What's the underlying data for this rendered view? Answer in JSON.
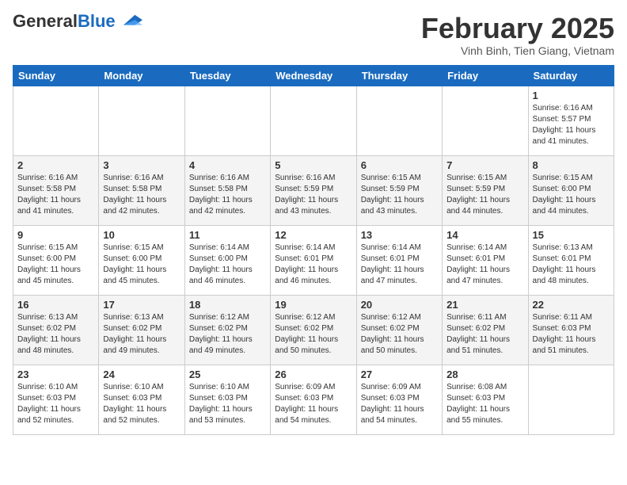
{
  "header": {
    "logo_general": "General",
    "logo_blue": "Blue",
    "month_title": "February 2025",
    "location": "Vinh Binh, Tien Giang, Vietnam"
  },
  "weekdays": [
    "Sunday",
    "Monday",
    "Tuesday",
    "Wednesday",
    "Thursday",
    "Friday",
    "Saturday"
  ],
  "weeks": [
    [
      {
        "day": "",
        "info": ""
      },
      {
        "day": "",
        "info": ""
      },
      {
        "day": "",
        "info": ""
      },
      {
        "day": "",
        "info": ""
      },
      {
        "day": "",
        "info": ""
      },
      {
        "day": "",
        "info": ""
      },
      {
        "day": "1",
        "info": "Sunrise: 6:16 AM\nSunset: 5:57 PM\nDaylight: 11 hours\nand 41 minutes."
      }
    ],
    [
      {
        "day": "2",
        "info": "Sunrise: 6:16 AM\nSunset: 5:58 PM\nDaylight: 11 hours\nand 41 minutes."
      },
      {
        "day": "3",
        "info": "Sunrise: 6:16 AM\nSunset: 5:58 PM\nDaylight: 11 hours\nand 42 minutes."
      },
      {
        "day": "4",
        "info": "Sunrise: 6:16 AM\nSunset: 5:58 PM\nDaylight: 11 hours\nand 42 minutes."
      },
      {
        "day": "5",
        "info": "Sunrise: 6:16 AM\nSunset: 5:59 PM\nDaylight: 11 hours\nand 43 minutes."
      },
      {
        "day": "6",
        "info": "Sunrise: 6:15 AM\nSunset: 5:59 PM\nDaylight: 11 hours\nand 43 minutes."
      },
      {
        "day": "7",
        "info": "Sunrise: 6:15 AM\nSunset: 5:59 PM\nDaylight: 11 hours\nand 44 minutes."
      },
      {
        "day": "8",
        "info": "Sunrise: 6:15 AM\nSunset: 6:00 PM\nDaylight: 11 hours\nand 44 minutes."
      }
    ],
    [
      {
        "day": "9",
        "info": "Sunrise: 6:15 AM\nSunset: 6:00 PM\nDaylight: 11 hours\nand 45 minutes."
      },
      {
        "day": "10",
        "info": "Sunrise: 6:15 AM\nSunset: 6:00 PM\nDaylight: 11 hours\nand 45 minutes."
      },
      {
        "day": "11",
        "info": "Sunrise: 6:14 AM\nSunset: 6:00 PM\nDaylight: 11 hours\nand 46 minutes."
      },
      {
        "day": "12",
        "info": "Sunrise: 6:14 AM\nSunset: 6:01 PM\nDaylight: 11 hours\nand 46 minutes."
      },
      {
        "day": "13",
        "info": "Sunrise: 6:14 AM\nSunset: 6:01 PM\nDaylight: 11 hours\nand 47 minutes."
      },
      {
        "day": "14",
        "info": "Sunrise: 6:14 AM\nSunset: 6:01 PM\nDaylight: 11 hours\nand 47 minutes."
      },
      {
        "day": "15",
        "info": "Sunrise: 6:13 AM\nSunset: 6:01 PM\nDaylight: 11 hours\nand 48 minutes."
      }
    ],
    [
      {
        "day": "16",
        "info": "Sunrise: 6:13 AM\nSunset: 6:02 PM\nDaylight: 11 hours\nand 48 minutes."
      },
      {
        "day": "17",
        "info": "Sunrise: 6:13 AM\nSunset: 6:02 PM\nDaylight: 11 hours\nand 49 minutes."
      },
      {
        "day": "18",
        "info": "Sunrise: 6:12 AM\nSunset: 6:02 PM\nDaylight: 11 hours\nand 49 minutes."
      },
      {
        "day": "19",
        "info": "Sunrise: 6:12 AM\nSunset: 6:02 PM\nDaylight: 11 hours\nand 50 minutes."
      },
      {
        "day": "20",
        "info": "Sunrise: 6:12 AM\nSunset: 6:02 PM\nDaylight: 11 hours\nand 50 minutes."
      },
      {
        "day": "21",
        "info": "Sunrise: 6:11 AM\nSunset: 6:02 PM\nDaylight: 11 hours\nand 51 minutes."
      },
      {
        "day": "22",
        "info": "Sunrise: 6:11 AM\nSunset: 6:03 PM\nDaylight: 11 hours\nand 51 minutes."
      }
    ],
    [
      {
        "day": "23",
        "info": "Sunrise: 6:10 AM\nSunset: 6:03 PM\nDaylight: 11 hours\nand 52 minutes."
      },
      {
        "day": "24",
        "info": "Sunrise: 6:10 AM\nSunset: 6:03 PM\nDaylight: 11 hours\nand 52 minutes."
      },
      {
        "day": "25",
        "info": "Sunrise: 6:10 AM\nSunset: 6:03 PM\nDaylight: 11 hours\nand 53 minutes."
      },
      {
        "day": "26",
        "info": "Sunrise: 6:09 AM\nSunset: 6:03 PM\nDaylight: 11 hours\nand 54 minutes."
      },
      {
        "day": "27",
        "info": "Sunrise: 6:09 AM\nSunset: 6:03 PM\nDaylight: 11 hours\nand 54 minutes."
      },
      {
        "day": "28",
        "info": "Sunrise: 6:08 AM\nSunset: 6:03 PM\nDaylight: 11 hours\nand 55 minutes."
      },
      {
        "day": "",
        "info": ""
      }
    ]
  ]
}
